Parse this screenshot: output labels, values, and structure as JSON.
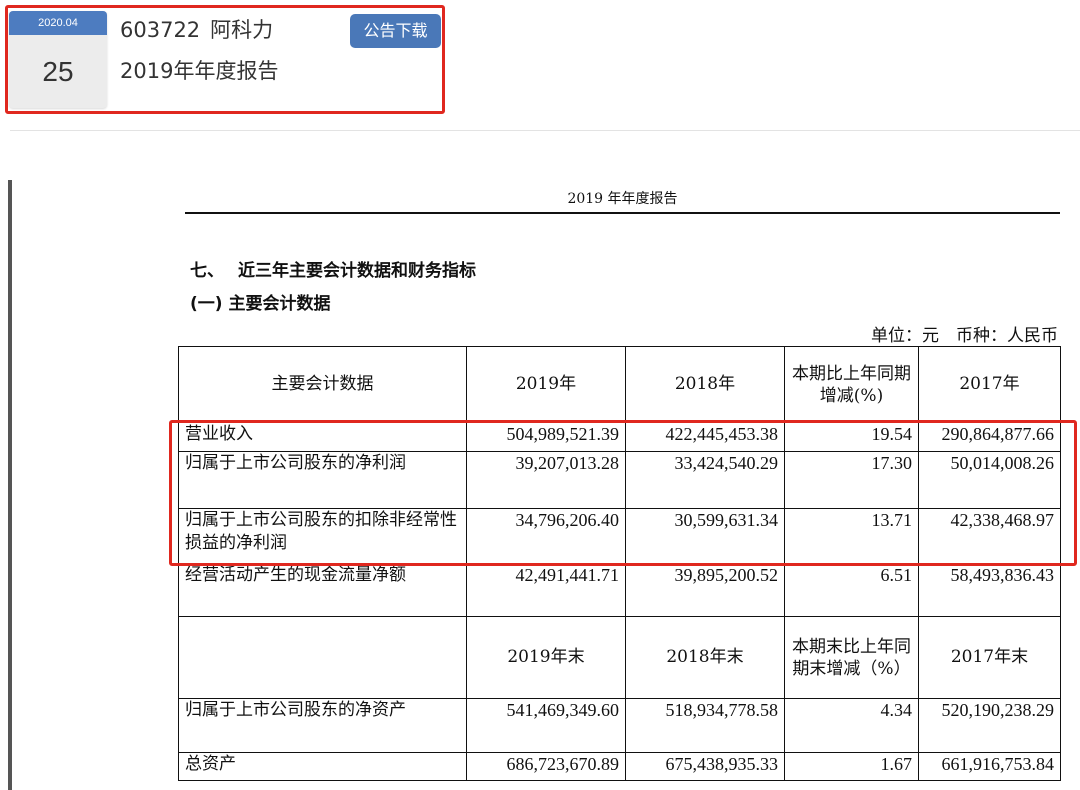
{
  "header": {
    "date_month": "2020.04",
    "date_day": "25",
    "stock_code": "603722",
    "company": "阿科力",
    "report_title": "2019年年度报告",
    "download_label": "公告下载"
  },
  "document": {
    "running_header": "2019 年年度报告",
    "section_number": "七、",
    "section_title": "近三年主要会计数据和财务指标",
    "subsection_title": "(一) 主要会计数据",
    "unit_label": "单位：元　币种：人民币"
  },
  "table": {
    "header": {
      "col0": "主要会计数据",
      "col1": "2019年",
      "col2": "2018年",
      "col3": "本期比上年同期增减(%)",
      "col4": "2017年"
    },
    "rows_a": [
      {
        "label": "营业收入",
        "y2019": "504,989,521.39",
        "y2018": "422,445,453.38",
        "change": "19.54",
        "y2017": "290,864,877.66"
      },
      {
        "label": "归属于上市公司股东的净利润",
        "y2019": "39,207,013.28",
        "y2018": "33,424,540.29",
        "change": "17.30",
        "y2017": "50,014,008.26"
      },
      {
        "label": "归属于上市公司股东的扣除非经常性损益的净利润",
        "y2019": "34,796,206.40",
        "y2018": "30,599,631.34",
        "change": "13.71",
        "y2017": "42,338,468.97"
      },
      {
        "label": "经营活动产生的现金流量净额",
        "y2019": "42,491,441.71",
        "y2018": "39,895,200.52",
        "change": "6.51",
        "y2017": "58,493,836.43"
      }
    ],
    "header2": {
      "col0": "",
      "col1": "2019年末",
      "col2": "2018年末",
      "col3": "本期末比上年同期末增减（%）",
      "col4": "2017年末"
    },
    "rows_b": [
      {
        "label": "归属于上市公司股东的净资产",
        "y2019": "541,469,349.60",
        "y2018": "518,934,778.58",
        "change": "4.34",
        "y2017": "520,190,238.29"
      },
      {
        "label": "总资产",
        "y2019": "686,723,670.89",
        "y2018": "675,438,935.33",
        "change": "1.67",
        "y2017": "661,916,753.84"
      }
    ]
  },
  "colors": {
    "highlight": "#e0281f",
    "accent": "#4a78b8"
  }
}
